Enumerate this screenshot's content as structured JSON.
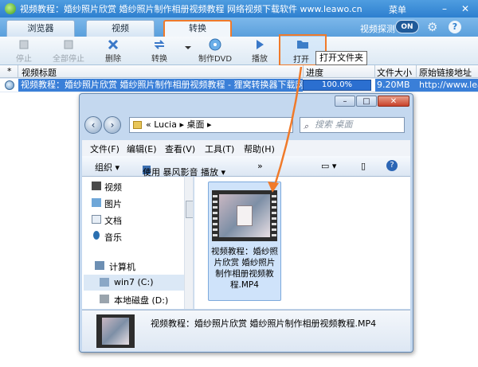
{
  "titlebar": {
    "title": "视频教程：婚纱照片欣赏 婚纱照片制作相册视频教程  网络视频下载软件 www.leawo.cn",
    "menu": "菜单",
    "minimize": "–",
    "close": "✕"
  },
  "tabs": [
    {
      "label": "浏览器"
    },
    {
      "label": "视频"
    },
    {
      "label": "转换"
    }
  ],
  "detect": {
    "label": "视频探测",
    "toggle": "ON"
  },
  "toolbar": {
    "stop": "停止",
    "stop_all": "全部停止",
    "delete": "删除",
    "convert": "转换",
    "make_dvd": "制作DVD",
    "play": "播放",
    "open": "打开"
  },
  "tooltip": "打开文件夹",
  "list": {
    "headers": {
      "star": "*",
      "title": "视频标题",
      "progress": "进度",
      "size": "文件大小",
      "url": "原始链接地址"
    },
    "row": {
      "title": "视频教程：婚纱照片欣赏 婚纱照片制作相册视频教程 - 狸窝转换器下载网",
      "progress": "100.0%",
      "size": "9.20MB",
      "url": "http://www.leawo.cn"
    }
  },
  "explorer": {
    "breadcrumb": "«  Lucia  ▸  桌面  ▸",
    "search_placeholder": "搜索 桌面",
    "menus": [
      "文件(F)",
      "编辑(E)",
      "查看(V)",
      "工具(T)",
      "帮助(H)"
    ],
    "cmd": {
      "organize": "组织 ▾",
      "play_with": "使用 暴风影音 播放  ▾",
      "more": "»"
    },
    "nav": {
      "video": "视频",
      "pictures": "图片",
      "documents": "文档",
      "music": "音乐",
      "computer": "计算机",
      "drive_c": "win7 (C:)",
      "drive_d": "本地磁盘 (D:)"
    },
    "file": {
      "name": "视频教程：婚纱照片欣赏 婚纱照片制作相册视频教程.MP4"
    },
    "detail": {
      "name": "视频教程：婚纱照片欣赏 婚纱照片制作相册视频教程.MP4"
    }
  },
  "colors": {
    "accent_orange": "#f07a2a",
    "selection_blue": "#3a7fd8"
  }
}
